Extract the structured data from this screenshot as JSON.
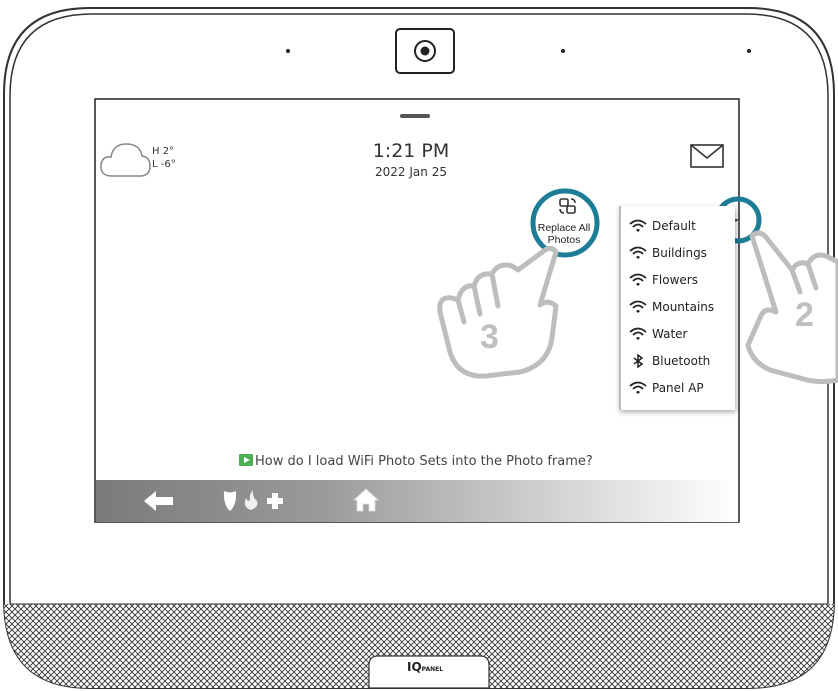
{
  "weather": {
    "high": "H 2°",
    "low": "L -6°",
    "icon": "cloud-icon"
  },
  "clock": {
    "time": "1:21 PM",
    "date": "2022 Jan 25"
  },
  "mail": {
    "icon": "envelope-icon"
  },
  "replace_photos": {
    "label_line1": "Replace All",
    "label_line2": "Photos",
    "icon": "replace-photos-icon"
  },
  "dropdown": {
    "items": [
      {
        "label": "Default",
        "icon": "wifi-icon"
      },
      {
        "label": "Buildings",
        "icon": "wifi-icon"
      },
      {
        "label": "Flowers",
        "icon": "wifi-icon"
      },
      {
        "label": "Mountains",
        "icon": "wifi-icon"
      },
      {
        "label": "Water",
        "icon": "wifi-icon"
      },
      {
        "label": "Bluetooth",
        "icon": "bluetooth-icon"
      },
      {
        "label": "Panel AP",
        "icon": "wifi-icon"
      }
    ]
  },
  "help": {
    "text": "How do I load WiFi Photo Sets into the Photo frame?",
    "icon": "play-video-icon"
  },
  "bottom_bar": {
    "back_icon": "back-arrow-icon",
    "shield_icon": "shield-icon",
    "fire_icon": "fire-icon",
    "plus_icon": "medical-plus-icon",
    "home_icon": "home-icon"
  },
  "steps": {
    "step2": "2",
    "step3": "3"
  },
  "brand": {
    "logo": "IQ",
    "sub": "PANEL"
  },
  "colors": {
    "highlight_ring": "#1e7d96",
    "help_icon": "#4caf50",
    "bar_gray": "#8a8a8a"
  }
}
